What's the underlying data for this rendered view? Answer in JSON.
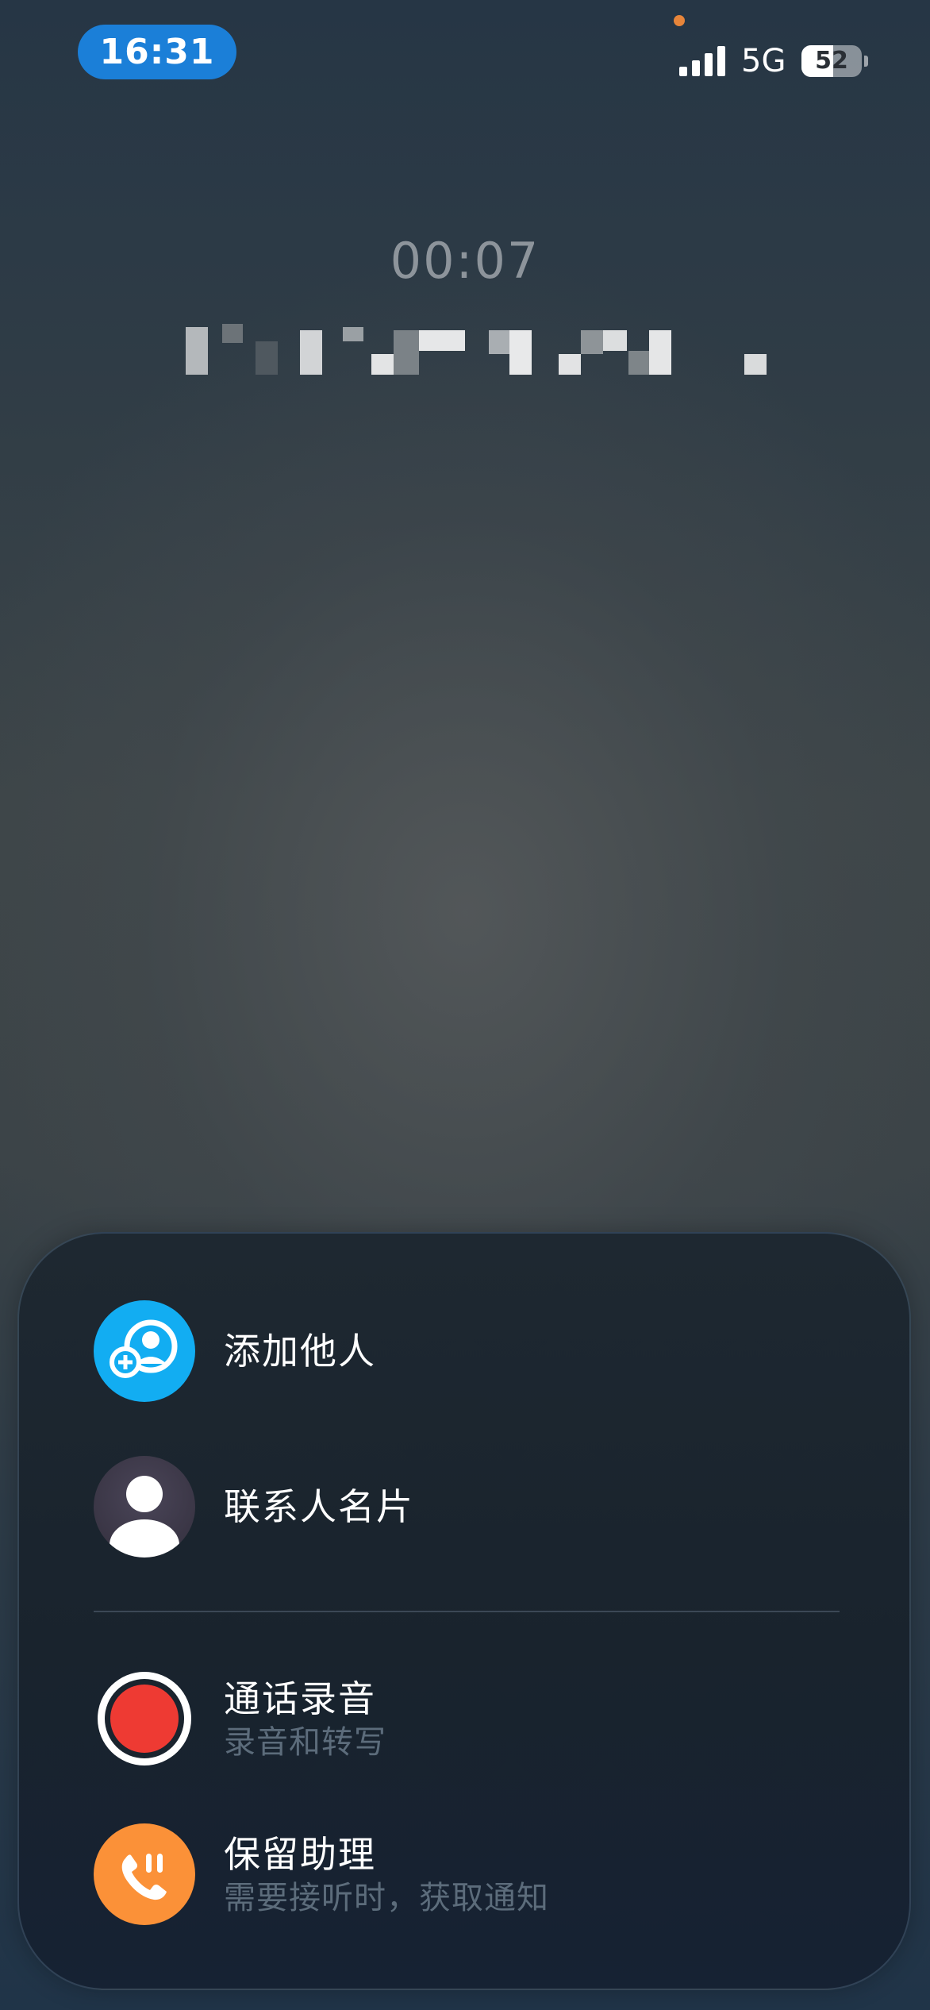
{
  "status_bar": {
    "time": "16:31",
    "network": "5G",
    "battery_level": "52",
    "battery_fraction": 0.52,
    "accent_color": "#1b7fd8"
  },
  "call": {
    "duration": "00:07",
    "caller_display": "redacted"
  },
  "menu": {
    "items": [
      {
        "id": "add-others",
        "title": "添加他人",
        "subtitle": "",
        "icon": "add-person-icon",
        "color": "#12adf2"
      },
      {
        "id": "contact-card",
        "title": "联系人名片",
        "subtitle": "",
        "icon": "contact-card-icon",
        "color": "#3f3b4c"
      },
      {
        "id": "call-recording",
        "title": "通话录音",
        "subtitle": "录音和转写",
        "icon": "record-icon",
        "color": "#ee3a33"
      },
      {
        "id": "hold-assist",
        "title": "保留助理",
        "subtitle": "需要接听时，获取通知",
        "icon": "hold-assist-icon",
        "color": "#fb9138"
      }
    ]
  }
}
